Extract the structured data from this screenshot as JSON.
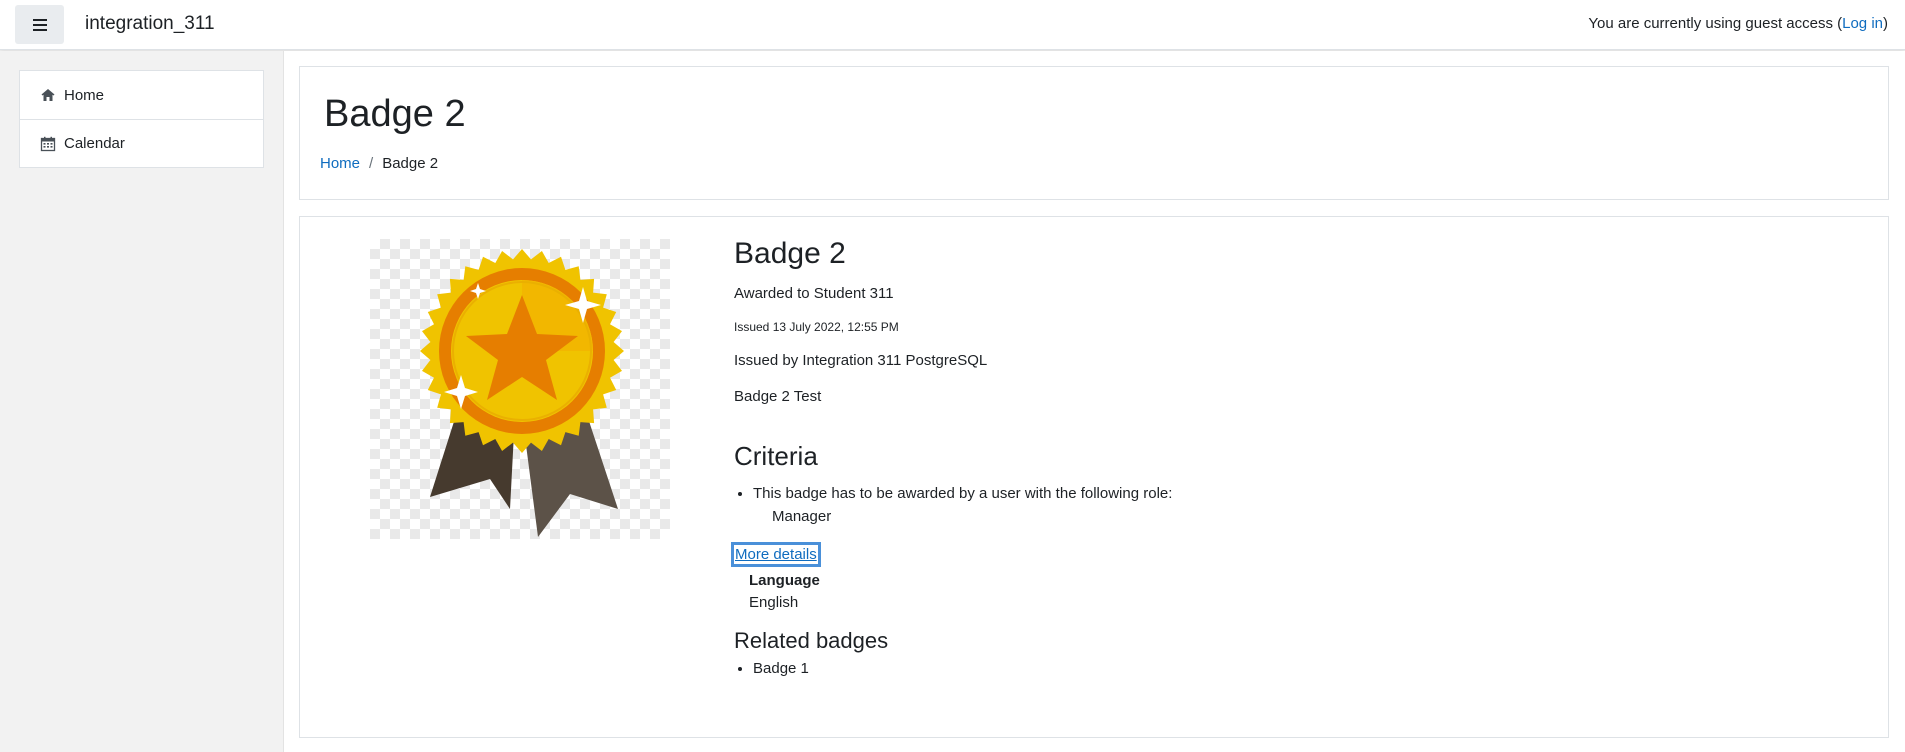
{
  "navbar": {
    "site_name": "integration_311",
    "login_prefix": "You are currently using guest access (",
    "login_link": "Log in",
    "login_suffix": ")"
  },
  "sidebar": {
    "items": [
      {
        "label": "Home",
        "icon": "home-icon"
      },
      {
        "label": "Calendar",
        "icon": "calendar-icon"
      }
    ]
  },
  "header": {
    "title": "Badge 2",
    "breadcrumb": [
      {
        "label": "Home"
      },
      {
        "label": "Badge 2"
      }
    ]
  },
  "badge": {
    "name": "Badge 2",
    "awarded_to": "Awarded to Student 311",
    "issued_on": "Issued 13 July 2022, 12:55 PM",
    "issued_by": "Issued by Integration 311 PostgreSQL",
    "description": "Badge 2 Test",
    "criteria_heading": "Criteria",
    "criteria_text": "This badge has to be awarded by a user with the following role:",
    "criteria_role": "Manager",
    "more_details": "More details",
    "language_label": "Language",
    "language_value": "English",
    "related_heading": "Related badges",
    "related": [
      "Badge 1"
    ]
  },
  "colors": {
    "link": "#0f6cbf",
    "medal_gold": "#f0c300",
    "medal_orange": "#e67e00",
    "ribbon": "#4a3f35"
  }
}
